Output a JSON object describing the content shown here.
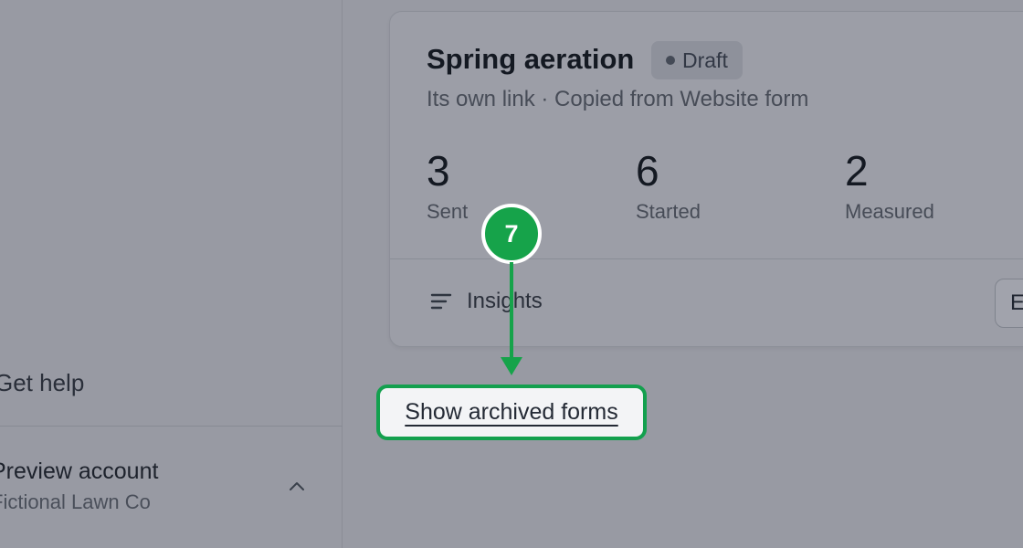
{
  "sidebar": {
    "help_label": "Get help",
    "account_name": "Preview account",
    "account_sub": "Fictional Lawn Co",
    "chevron_icon": "chevron-up-icon"
  },
  "card": {
    "title": "Spring aeration",
    "badge": "Draft",
    "subtitle": "Its own link · Copied from Website form",
    "stats": [
      {
        "value": "3",
        "label": "Sent"
      },
      {
        "value": "6",
        "label": "Started"
      },
      {
        "value": "2",
        "label": "Measured"
      }
    ],
    "insights_label": "Insights",
    "insights_icon": "filter-lines-icon",
    "side_button_label": "E"
  },
  "archived_link": "Show archived forms",
  "annotation": {
    "step_number": "7",
    "color": "#16a34a"
  }
}
